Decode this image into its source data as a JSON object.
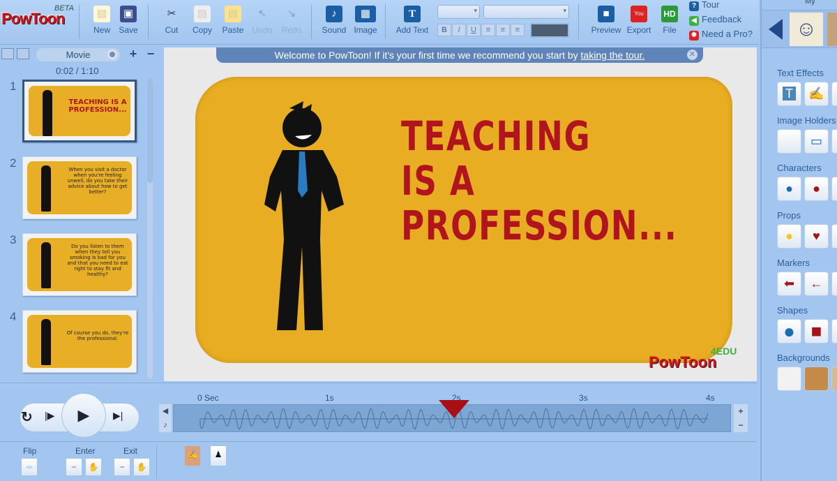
{
  "app": {
    "logo": "PowToon",
    "badge": "BETA"
  },
  "toolbar": {
    "new": "New",
    "save": "Save",
    "cut": "Cut",
    "copy": "Copy",
    "paste": "Paste",
    "undo": "Undo",
    "redo": "Redo",
    "sound": "Sound",
    "image": "Image",
    "add_text": "Add Text",
    "preview": "Preview",
    "export": "Export",
    "file": "File",
    "hd": "HD",
    "tour": "Tour",
    "feedback": "Feedback",
    "need_pro": "Need a Pro?",
    "format": {
      "bold": "B",
      "italic": "I",
      "underline": "U"
    }
  },
  "left": {
    "mode": "Movie",
    "time": "0:02 / 1:10",
    "slides": [
      {
        "n": "1",
        "text": "TEACHING IS A PROFESSION..."
      },
      {
        "n": "2",
        "text": "When you visit a doctor when you're feeling unwell, do you take their advice about how to get better?"
      },
      {
        "n": "3",
        "text": "Do you listen to them when they tell you smoking is bad for you and that you need to eat right to stay fit and healthy?"
      },
      {
        "n": "4",
        "text": "Of course you do, they're the professional."
      }
    ]
  },
  "banner": {
    "text": "Welcome to PowToon! If it's your first time we recommend you start by ",
    "link": "taking the tour."
  },
  "canvas": {
    "title_line1": "TEACHING IS A",
    "title_line2": "PROFESSION...",
    "watermark": "PowToon",
    "watermark_badge": "4EDU"
  },
  "right": {
    "header": "My",
    "categories": [
      "Text Effects",
      "Image Holders",
      "Characters",
      "Props",
      "Markers",
      "Shapes",
      "Backgrounds"
    ]
  },
  "timeline": {
    "ticks": [
      "0 Sec",
      "1s",
      "2s",
      "3s",
      "4s"
    ],
    "playhead_seconds": 2.0
  },
  "bottom": {
    "flip": "Flip",
    "enter": "Enter",
    "exit": "Exit"
  }
}
